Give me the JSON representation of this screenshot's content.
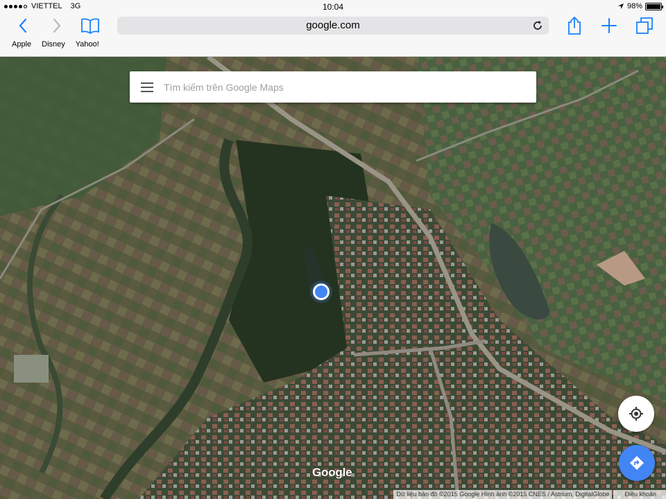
{
  "status_bar": {
    "carrier": "VIETTEL",
    "network": "3G",
    "time": "10:04",
    "battery_percent": "98%",
    "battery_level": 0.98,
    "signal_bars_filled": 4,
    "signal_bars_total": 5
  },
  "browser": {
    "url": "google.com",
    "bookmarks": [
      "Apple",
      "Disney",
      "Yahoo!"
    ],
    "accent_color": "#1a82fb"
  },
  "map": {
    "search_placeholder": "Tìm kiếm trên Google Maps",
    "logo": "Google",
    "attribution": "Dữ liệu bản đồ ©2015 Google Hình ảnh ©2015 CNES / Astrium, DigitalGlobe",
    "terms": "Điều khoản",
    "location_color": "#4285f4",
    "directions_color": "#4285f4"
  },
  "icons": {
    "back": "back-chevron-icon",
    "forward": "forward-chevron-icon",
    "bookmarks": "open-book-icon",
    "share": "share-icon",
    "new_tab": "plus-icon",
    "tabs": "tabs-icon",
    "reload": "reload-icon",
    "menu": "hamburger-menu-icon",
    "my_location": "my-location-icon",
    "directions": "directions-icon"
  }
}
